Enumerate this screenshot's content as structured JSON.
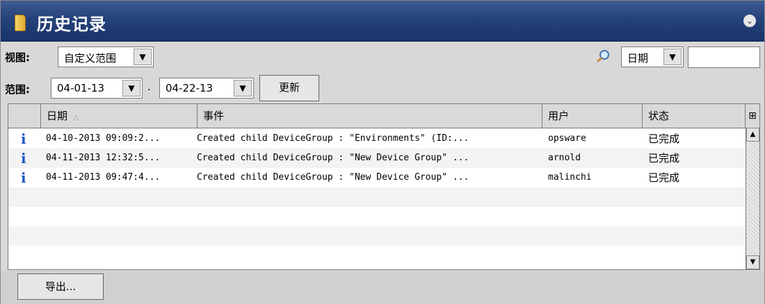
{
  "title": "历史记录",
  "icons": {
    "title": "history-folder-icon",
    "collapse": "collapse-chevron-icon",
    "search": "magnifier-icon",
    "info": "info-icon"
  },
  "filters": {
    "view_label": "视图:",
    "view_value": "自定义范围",
    "range_label": "范围:",
    "date_from": "04-01-13",
    "date_sep": ".",
    "date_to": "04-22-13",
    "refresh_button": "更新",
    "search_field_select": "日期",
    "search_value": ""
  },
  "table": {
    "headers": [
      "日期",
      "事件",
      "用户",
      "状态"
    ],
    "rows": [
      {
        "date": "04-10-2013 09:09:2...",
        "event": "Created child DeviceGroup : \"Environments\" (ID:...",
        "user": "opsware",
        "status": "已完成"
      },
      {
        "date": "04-11-2013 12:32:5...",
        "event": "Created child DeviceGroup : \"New Device Group\" ...",
        "user": "arnold",
        "status": "已完成"
      },
      {
        "date": "04-11-2013 09:47:4...",
        "event": "Created child DeviceGroup : \"New Device Group\" ...",
        "user": "malinchi",
        "status": "已完成"
      }
    ]
  },
  "export_button": "导出...",
  "colors": {
    "title_bar": "#24427a",
    "info_icon": "#1c57c5",
    "panel": "#d8d8d8"
  }
}
